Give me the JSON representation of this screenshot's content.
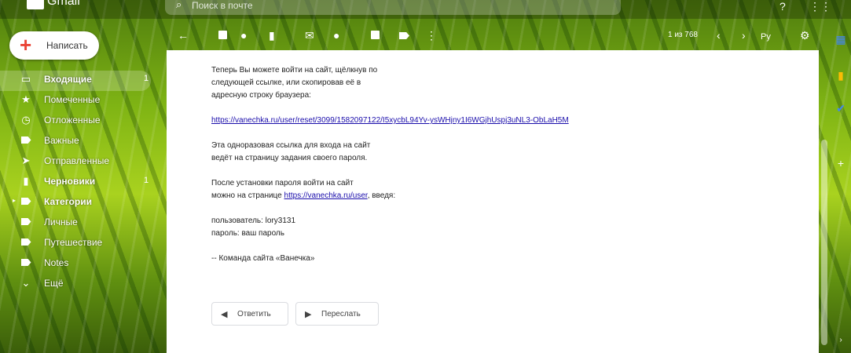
{
  "app": {
    "name": "Gmail"
  },
  "search": {
    "placeholder": "Поиск в почте"
  },
  "compose": {
    "label": "Написать"
  },
  "sidebar": {
    "items": [
      {
        "label": "Входящие",
        "count": "1",
        "icon": "inbox-icon"
      },
      {
        "label": "Помеченные",
        "count": "",
        "icon": "star-icon"
      },
      {
        "label": "Отложенные",
        "count": "",
        "icon": "clock-icon"
      },
      {
        "label": "Важные",
        "count": "",
        "icon": "important-icon"
      },
      {
        "label": "Отправленные",
        "count": "",
        "icon": "send-icon"
      },
      {
        "label": "Черновики",
        "count": "1",
        "icon": "draft-icon"
      },
      {
        "label": "Категории",
        "count": "",
        "icon": "label-icon"
      },
      {
        "label": "Личные",
        "count": "",
        "icon": "label-icon"
      },
      {
        "label": "Путешествие",
        "count": "",
        "icon": "label-icon"
      },
      {
        "label": "Notes",
        "count": "",
        "icon": "label-icon"
      },
      {
        "label": "Ещё",
        "count": "",
        "icon": "chevron-down-icon"
      }
    ]
  },
  "toolbar": {
    "pager": "1 из 768",
    "lang": "Ру"
  },
  "email": {
    "p1": "Теперь Вы можете войти на сайт, щёлкнув по следующей ссылке, или скопировав её в адресную строку браузера:",
    "link": "https://vanechka.ru/user/reset/3099/1582097122/I5xycbL94Yv-ysWHjny1I6WGjhUspj3uNL3-ObLaH5M",
    "p2a": "Эта одноразовая ссылка для входа на сайт",
    "p2b": "ведёт на страницу задания своего пароля.",
    "p3a": "После установки пароля войти на сайт",
    "p3b_pre": "можно на странице ",
    "p3b_link": "https://vanechka.ru/user",
    "p3b_post": ", введя:",
    "user": "пользователь: lory3131",
    "pass": "пароль: ваш пароль",
    "sign": "-- Команда сайта «Ванечка»"
  },
  "actions": {
    "reply": "Ответить",
    "forward": "Переслать"
  },
  "colors": {
    "accent_red": "#ea4335",
    "link": "#1a0dab"
  }
}
